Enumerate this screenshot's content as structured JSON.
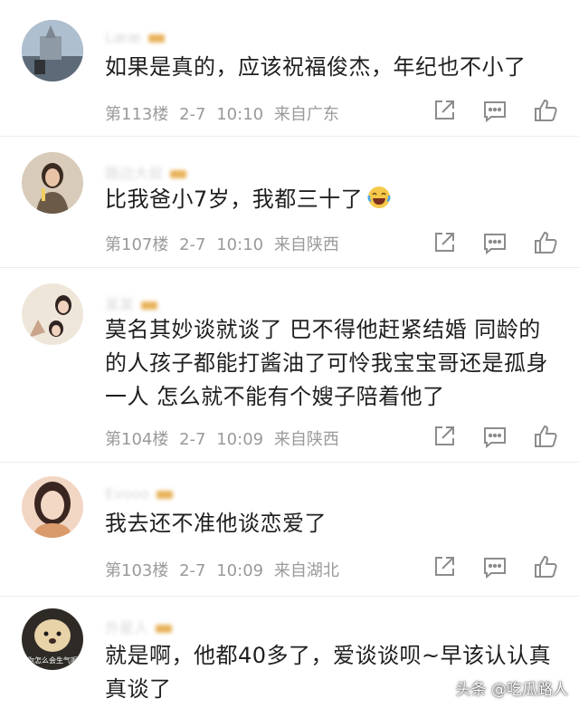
{
  "comments": [
    {
      "name": "Lææ",
      "text": "如果是真的，应该祝福俊杰，年纪也不小了",
      "floor": "第113楼",
      "date": "2-7",
      "time": "10:10",
      "location": "来自广东",
      "avatar_bg": "#7a8fa8"
    },
    {
      "name": "路边大叔",
      "text": "比我爸小7岁，我都三十了",
      "emoji": "laughing-tears-emoji",
      "floor": "第107楼",
      "date": "2-7",
      "time": "10:10",
      "location": "来自陕西",
      "avatar_bg": "#c9b9a6"
    },
    {
      "name": "某某",
      "text": "莫名其妙谈就谈了 巴不得他赶紧结婚 同龄的的人孩子都能打酱油了可怜我宝宝哥还是孤身一人 怎么就不能有个嫂子陪着他了",
      "floor": "第104楼",
      "date": "2-7",
      "time": "10:09",
      "location": "来自陕西",
      "avatar_bg": "#e7dccf"
    },
    {
      "name": "Evooo",
      "text": "我去还不准他谈恋爱了",
      "floor": "第103楼",
      "date": "2-7",
      "time": "10:09",
      "location": "来自湖北",
      "avatar_bg": "#e9c9b8"
    },
    {
      "name": "外星人",
      "text": "就是啊，他都40多了，爱谈谈呗~早该认认真真谈了",
      "avatar_caption": "你怎么会生气呢",
      "avatar_bg": "#2e2a26"
    }
  ],
  "icons": {
    "share": "share-icon",
    "comment": "comment-icon",
    "like": "thumbs-up-icon"
  },
  "watermark": "头条 @吃瓜路人",
  "colors": {
    "text": "#1f1f1f",
    "meta": "#9a9a9a",
    "icon": "#8c8c8c",
    "badge": "#e8b25a"
  }
}
